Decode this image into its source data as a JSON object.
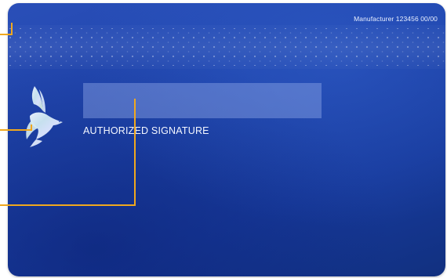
{
  "card": {
    "manufacturer_text": "Manufacturer 123456 00/00",
    "signature_label": "AUTHORIZED SIGNATURE"
  },
  "hologram": {
    "icon": "dove-hologram-icon"
  },
  "colors": {
    "card_blue": "#1f45ad",
    "callout_line": "#f0a81e"
  }
}
